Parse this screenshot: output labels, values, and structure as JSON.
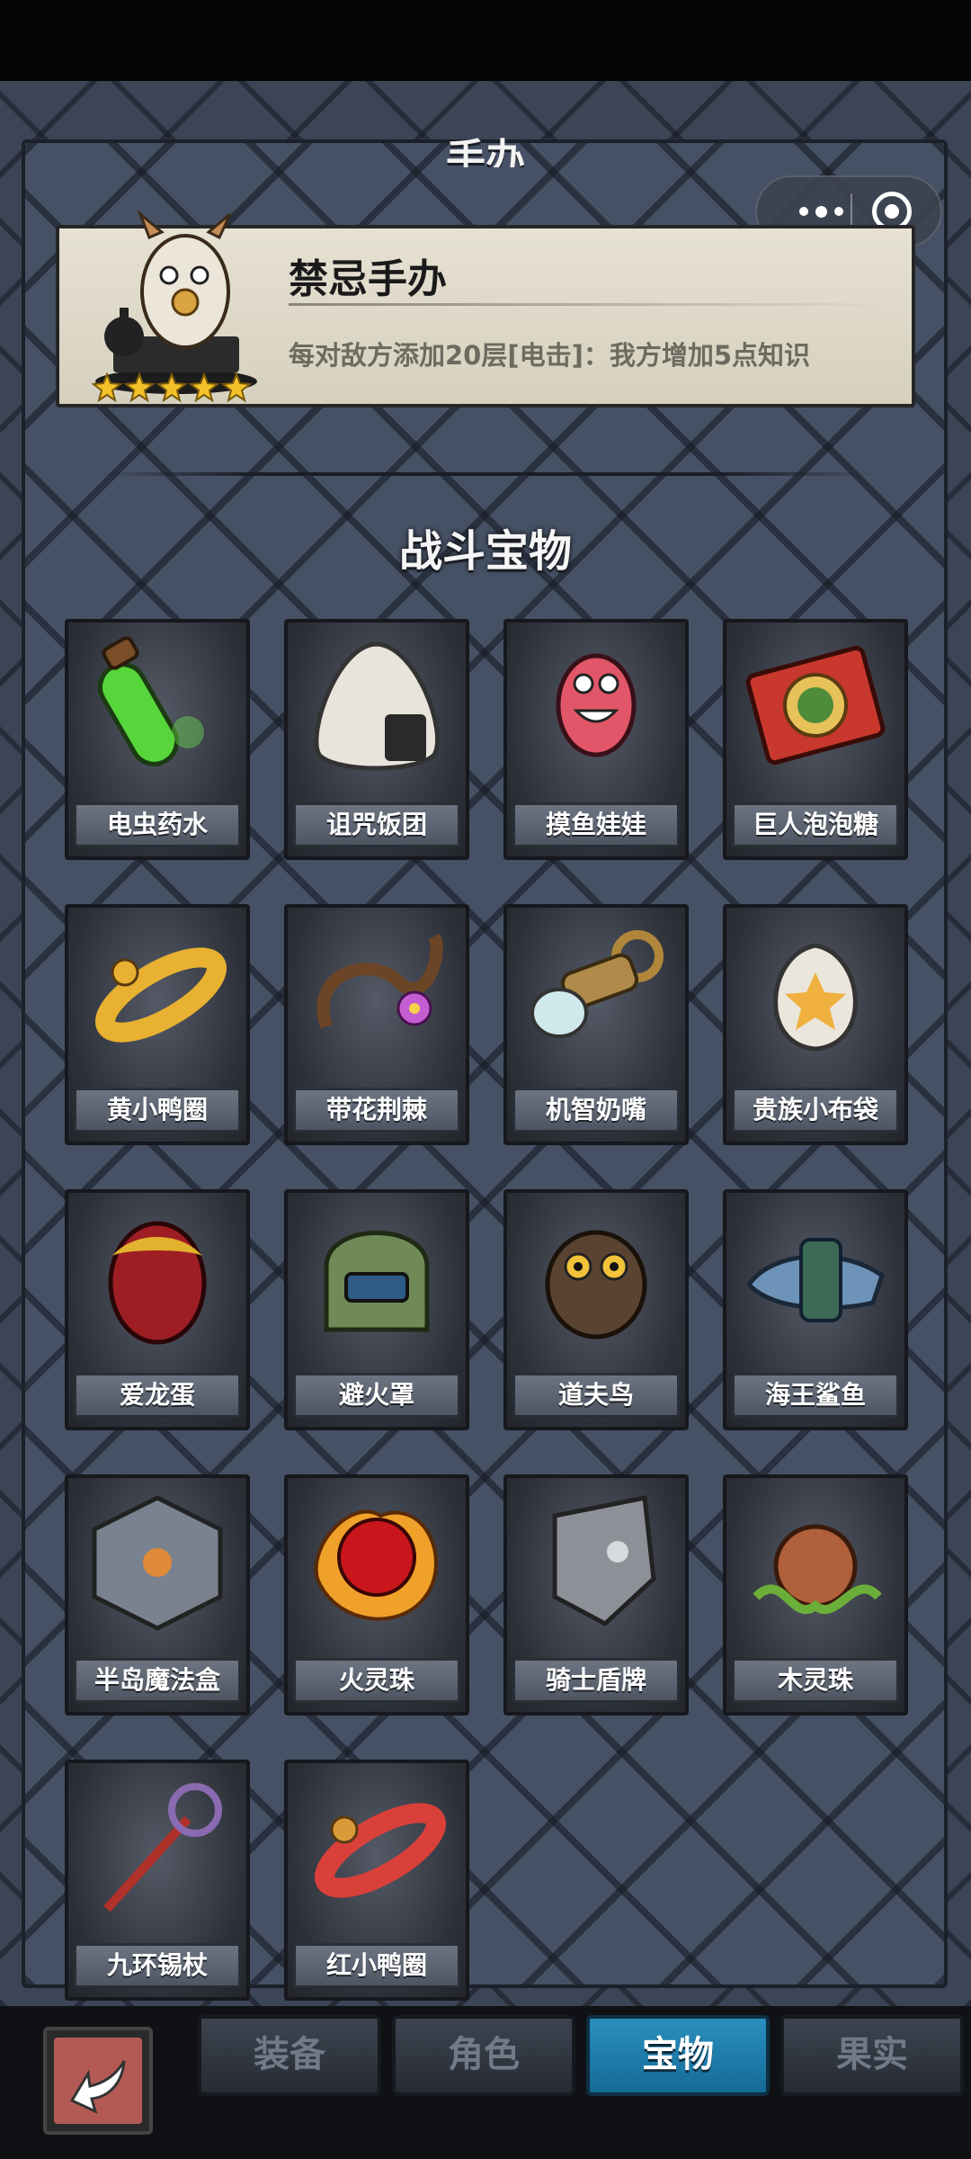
{
  "header": {
    "section_heading": "手办"
  },
  "capsule": {
    "more_icon": "more-dots-icon",
    "close_icon": "target-close-icon"
  },
  "figure": {
    "name": "禁忌手办",
    "description": "每对敌方添加20层[电击]：我方增加5点知识",
    "stars": 5
  },
  "treasures": {
    "title": "战斗宝物",
    "items": [
      {
        "label": "电虫药水",
        "icon": "green-potion-icon"
      },
      {
        "label": "诅咒饭团",
        "icon": "rice-ball-icon"
      },
      {
        "label": "摸鱼娃娃",
        "icon": "pink-doll-icon"
      },
      {
        "label": "巨人泡泡糖",
        "icon": "gum-box-icon"
      },
      {
        "label": "黄小鸭圈",
        "icon": "yellow-duck-ring-icon"
      },
      {
        "label": "带花荆棘",
        "icon": "thorn-flower-icon"
      },
      {
        "label": "机智奶嘴",
        "icon": "pacifier-icon"
      },
      {
        "label": "贵族小布袋",
        "icon": "cloth-bag-icon"
      },
      {
        "label": "爱龙蛋",
        "icon": "dragon-egg-icon"
      },
      {
        "label": "避火罩",
        "icon": "fire-mask-icon"
      },
      {
        "label": "道夫鸟",
        "icon": "owl-icon"
      },
      {
        "label": "海王鲨鱼",
        "icon": "shark-icon"
      },
      {
        "label": "半岛魔法盒",
        "icon": "magic-cube-icon"
      },
      {
        "label": "火灵珠",
        "icon": "fire-orb-icon"
      },
      {
        "label": "骑士盾牌",
        "icon": "knight-shield-icon"
      },
      {
        "label": "木灵珠",
        "icon": "wood-orb-icon"
      },
      {
        "label": "九环锡杖",
        "icon": "staff-icon"
      },
      {
        "label": "红小鸭圈",
        "icon": "red-duck-ring-icon"
      }
    ]
  },
  "nav": {
    "back_icon": "back-arrow-icon",
    "tabs": [
      {
        "label": "装备",
        "active": false
      },
      {
        "label": "角色",
        "active": false
      },
      {
        "label": "宝物",
        "active": true
      },
      {
        "label": "果实",
        "active": false
      }
    ]
  },
  "colors": {
    "active_tab": "#1f80b0",
    "card_bg": "#ded8c8",
    "label_bg": "#5d6572"
  }
}
